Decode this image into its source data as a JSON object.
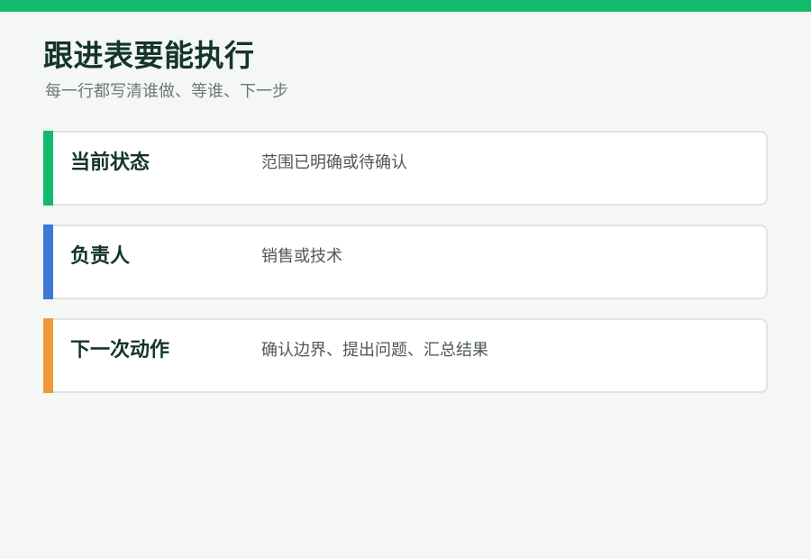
{
  "colors": {
    "top_bar": "#11bb6b",
    "background": "#f5f7f5",
    "title_text": "#14352a",
    "subtitle_text": "#6d7a74"
  },
  "header": {
    "title": "跟进表要能执行",
    "subtitle": "每一行都写清谁做、等谁、下一步"
  },
  "rows": [
    {
      "label": "当前状态",
      "value": "范围已明确或待确认",
      "accent_color": "#11bb6b"
    },
    {
      "label": "负责人",
      "value": "销售或技术",
      "accent_color": "#3d78d6"
    },
    {
      "label": "下一次动作",
      "value": "确认边界、提出问题、汇总结果",
      "accent_color": "#ef9a3a"
    }
  ]
}
